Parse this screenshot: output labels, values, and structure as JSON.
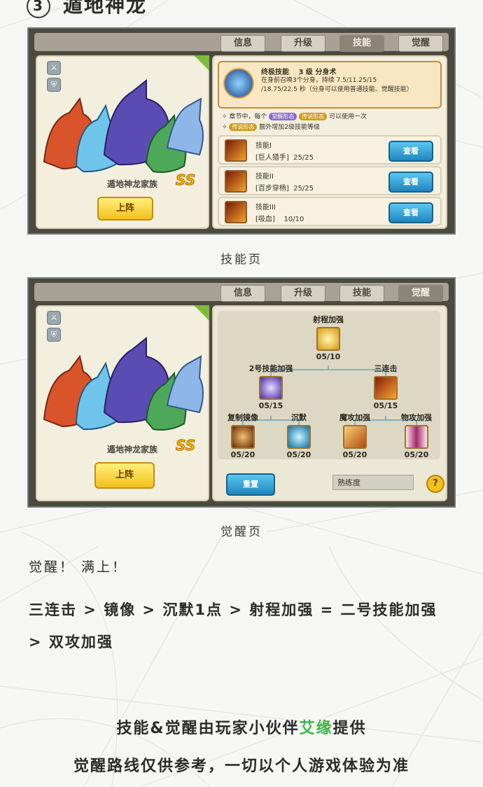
{
  "heading": {
    "number": "3",
    "title": "遁地神龙"
  },
  "tabs": [
    "信息",
    "升级",
    "技能",
    "觉醒"
  ],
  "hero": {
    "team_name": "遁地神龙家族",
    "rank": "SS",
    "deploy_label": "上阵"
  },
  "skill_page": {
    "ultimate": {
      "label": "终极技能",
      "level": "3 级 分身术",
      "desc_line1": "在身前召唤3个分身，持续 7.5/11.25/15",
      "desc_line2": "/18.75/22.5 秒（分身可以使用普通技能、觉醒技能）"
    },
    "note1_prefix": "章节中，每个",
    "note1_chip1": "觉醒形态",
    "note1_chip2": "传说形态",
    "note1_suffix": "可以使用一次",
    "note2_chip": "传说形态",
    "note2_suffix": "额外增加2级技能等级",
    "skills": [
      {
        "name": "技能I",
        "detail": "[巨人猎手]",
        "value": "25/25"
      },
      {
        "name": "技能II",
        "detail": "[百步穿杨]",
        "value": "25/25"
      },
      {
        "name": "技能III",
        "detail": "[吸血]",
        "value": "10/10"
      }
    ],
    "view_label": "查看"
  },
  "skill_caption": "技能页",
  "awaken_page": {
    "root": {
      "label": "射程加强",
      "value": "05/10"
    },
    "mid": [
      {
        "label": "2号技能加强",
        "value": "05/15"
      },
      {
        "label": "三连击",
        "value": "05/15"
      }
    ],
    "leaves": [
      {
        "label": "复制镜像",
        "value": "05/20"
      },
      {
        "label": "沉默",
        "value": "05/20"
      },
      {
        "label": "魔攻加强",
        "value": "05/20"
      },
      {
        "label": "物攻加强",
        "value": "05/20"
      }
    ],
    "reset_label": "重置",
    "proficiency_label": "熟练度",
    "help_label": "?"
  },
  "awaken_caption": "觉醒页",
  "body_line1": "觉醒！ 满上！",
  "body_line2": "三连击 > 镜像 > 沉默1点 > 射程加强 = 二号技能加强 > 双攻加强",
  "credit_prefix": "技能&觉醒由玩家小伙伴",
  "credit_name": "艾缘",
  "credit_suffix": "提供",
  "disclaimer": "觉醒路线仅供参考，一切以个人游戏体验为准",
  "colors": {
    "accent_green": "#39b54a",
    "button_blue": "#1f86bf",
    "gold": "#f2c11d"
  }
}
